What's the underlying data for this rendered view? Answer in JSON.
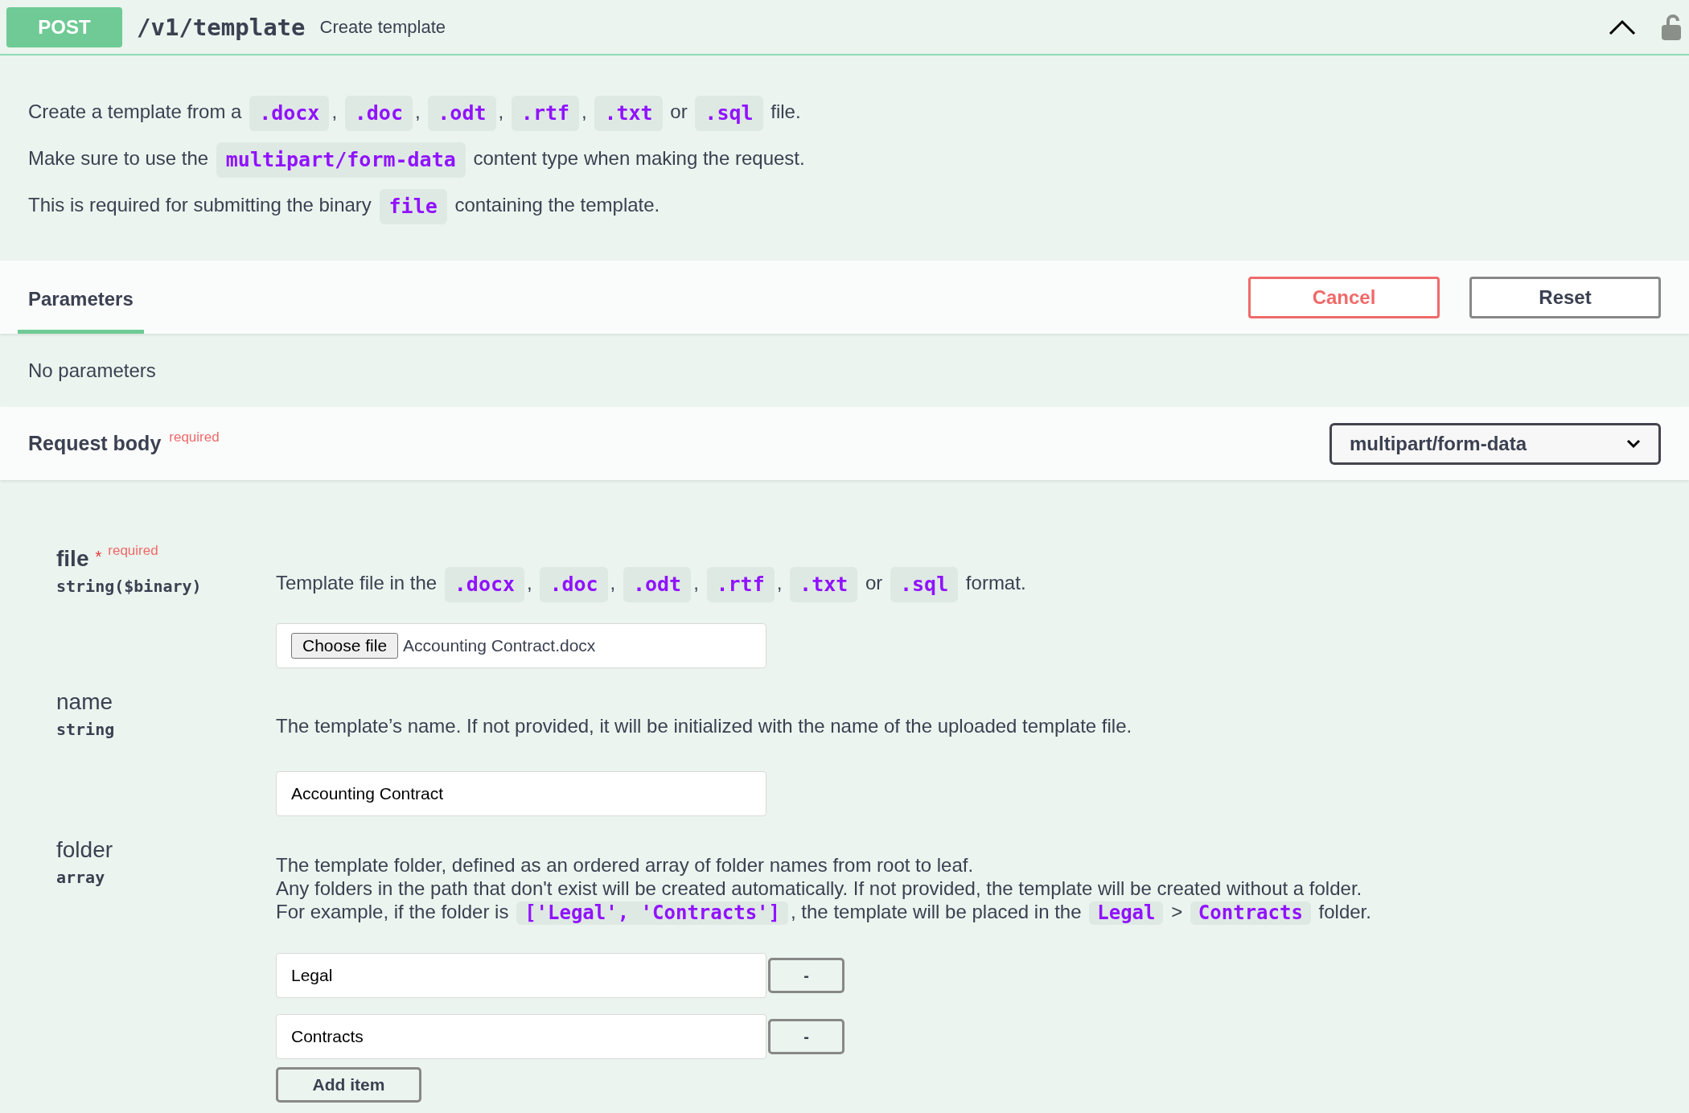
{
  "operation": {
    "method": "POST",
    "path": "/v1/template",
    "summary": "Create template",
    "expanded": true,
    "locked": false
  },
  "description": [
    [
      {
        "kind": "text",
        "text": "Create a template from a "
      },
      {
        "kind": "code",
        "text": ".docx"
      },
      {
        "kind": "text",
        "text": ", "
      },
      {
        "kind": "code",
        "text": ".doc"
      },
      {
        "kind": "text",
        "text": ", "
      },
      {
        "kind": "code",
        "text": ".odt"
      },
      {
        "kind": "text",
        "text": ", "
      },
      {
        "kind": "code",
        "text": ".rtf"
      },
      {
        "kind": "text",
        "text": ", "
      },
      {
        "kind": "code",
        "text": ".txt"
      },
      {
        "kind": "text",
        "text": " or "
      },
      {
        "kind": "code",
        "text": ".sql"
      },
      {
        "kind": "text",
        "text": " file."
      }
    ],
    [
      {
        "kind": "text",
        "text": "Make sure to use the "
      },
      {
        "kind": "code",
        "text": "multipart/form-data"
      },
      {
        "kind": "text",
        "text": " content type when making the request."
      }
    ],
    [
      {
        "kind": "text",
        "text": "This is required for submitting the binary "
      },
      {
        "kind": "code",
        "text": "file"
      },
      {
        "kind": "text",
        "text": " containing the template."
      }
    ]
  ],
  "parameters": {
    "tab": {
      "label": "Parameters",
      "selected": true
    },
    "buttons": [
      {
        "label": "Cancel",
        "kind": "cancel"
      },
      {
        "label": "Reset",
        "kind": "reset"
      }
    ],
    "empty_message": "No parameters"
  },
  "request_body": {
    "title": "Request body",
    "required_label": "required",
    "content_type": "multipart/form-data"
  },
  "fields": [
    {
      "name": "file",
      "required": true,
      "required_mark": "*",
      "required_label": "required",
      "type": "string($binary)",
      "kind": "file",
      "description": [
        [
          {
            "kind": "text",
            "text": "Template file in the "
          },
          {
            "kind": "code",
            "text": ".docx"
          },
          {
            "kind": "text",
            "text": ", "
          },
          {
            "kind": "code",
            "text": ".doc"
          },
          {
            "kind": "text",
            "text": ", "
          },
          {
            "kind": "code",
            "text": ".odt"
          },
          {
            "kind": "text",
            "text": ", "
          },
          {
            "kind": "code",
            "text": ".rtf"
          },
          {
            "kind": "text",
            "text": ", "
          },
          {
            "kind": "code",
            "text": ".txt"
          },
          {
            "kind": "text",
            "text": " or "
          },
          {
            "kind": "code",
            "text": ".sql"
          },
          {
            "kind": "text",
            "text": " format."
          }
        ]
      ],
      "button": "Choose file",
      "value": "Accounting Contract.docx"
    },
    {
      "name": "name",
      "required": false,
      "type": "string",
      "kind": "text",
      "description": [
        [
          {
            "kind": "text",
            "text": "The template’s name. If not provided, it will be initialized with the name of the uploaded template file."
          }
        ]
      ],
      "value": "Accounting Contract"
    },
    {
      "name": "folder",
      "required": false,
      "type": "array",
      "kind": "array",
      "description": [
        [
          {
            "kind": "text",
            "text": "The template folder, defined as an ordered array of folder names from root to leaf."
          }
        ],
        [
          {
            "kind": "text",
            "text": "Any folders in the path that don't exist will be created automatically. If not provided, the template will be created without a folder."
          }
        ],
        [
          {
            "kind": "text",
            "text": "For example, if the folder is "
          },
          {
            "kind": "code",
            "text": "['Legal', 'Contracts']"
          },
          {
            "kind": "text",
            "text": ", the template will be placed in the "
          },
          {
            "kind": "code",
            "text": "Legal"
          },
          {
            "kind": "text",
            "text": " > "
          },
          {
            "kind": "code",
            "text": "Contracts"
          },
          {
            "kind": "text",
            "text": " folder."
          }
        ]
      ],
      "items": [
        {
          "value": "Legal",
          "remove": "-"
        },
        {
          "value": "Contracts",
          "remove": "-"
        }
      ],
      "add": "Add item"
    }
  ]
}
